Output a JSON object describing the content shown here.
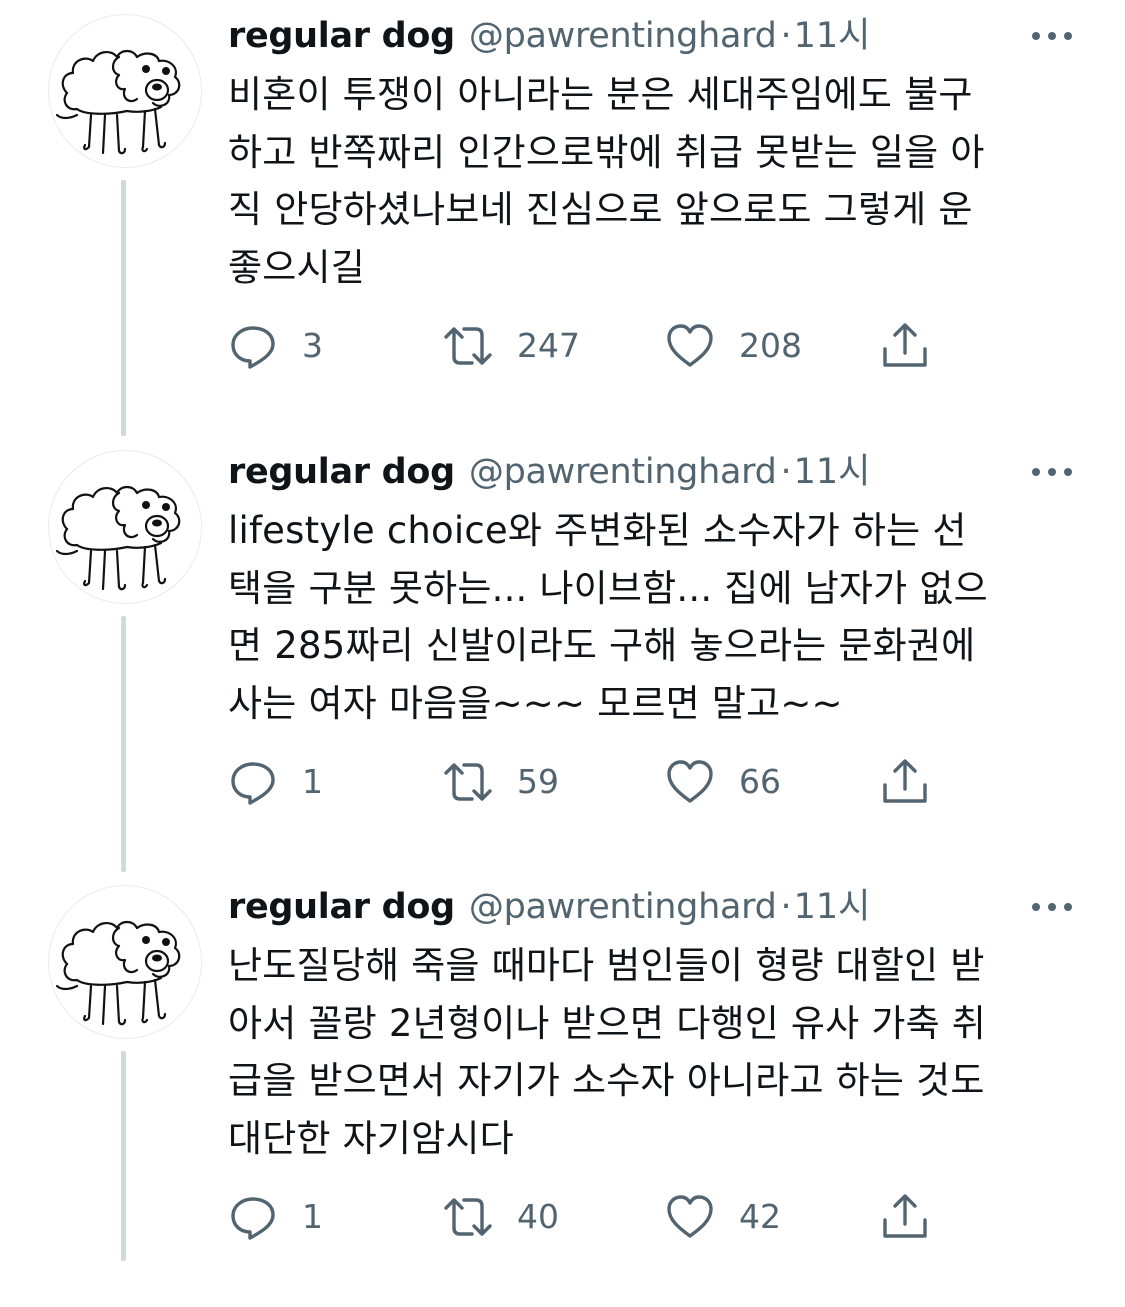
{
  "colors": {
    "text_primary": "#0f1419",
    "text_secondary": "#536471",
    "thread_line": "#cfd9de",
    "background": "#ffffff"
  },
  "icons": {
    "reply": "reply-icon",
    "retweet": "retweet-icon",
    "like": "heart-icon",
    "share": "share-icon",
    "more": "more-icon"
  },
  "tweets": [
    {
      "display_name": "regular dog",
      "handle": "@pawrentinghard",
      "separator": "·",
      "time": "11시",
      "text_lines": [
        "비혼이 투쟁이 아니라는 분은 세대주임에도 불구",
        "하고 반쪽짜리 인간으로밖에 취급 못받는 일을 아",
        "직 안당하셨나보네 진심으로 앞으로도 그렇게 운",
        "좋으시길"
      ],
      "replies": "3",
      "retweets": "247",
      "likes": "208"
    },
    {
      "display_name": "regular dog",
      "handle": "@pawrentinghard",
      "separator": "·",
      "time": "11시",
      "text_lines": [
        "lifestyle choice와 주변화된 소수자가 하는 선",
        "택을 구분 못하는... 나이브함... 집에 남자가 없으",
        "면 285짜리 신발이라도 구해 놓으라는 문화권에",
        "사는 여자 마음을~~~ 모르면 말고~~"
      ],
      "replies": "1",
      "retweets": "59",
      "likes": "66"
    },
    {
      "display_name": "regular dog",
      "handle": "@pawrentinghard",
      "separator": "·",
      "time": "11시",
      "text_lines": [
        "난도질당해 죽을 때마다 범인들이 형량 대할인 받",
        "아서 꼴랑 2년형이나 받으면 다행인 유사 가축 취",
        "급을 받으면서 자기가 소수자 아니라고 하는 것도",
        "대단한 자기암시다"
      ],
      "replies": "1",
      "retweets": "40",
      "likes": "42"
    }
  ]
}
